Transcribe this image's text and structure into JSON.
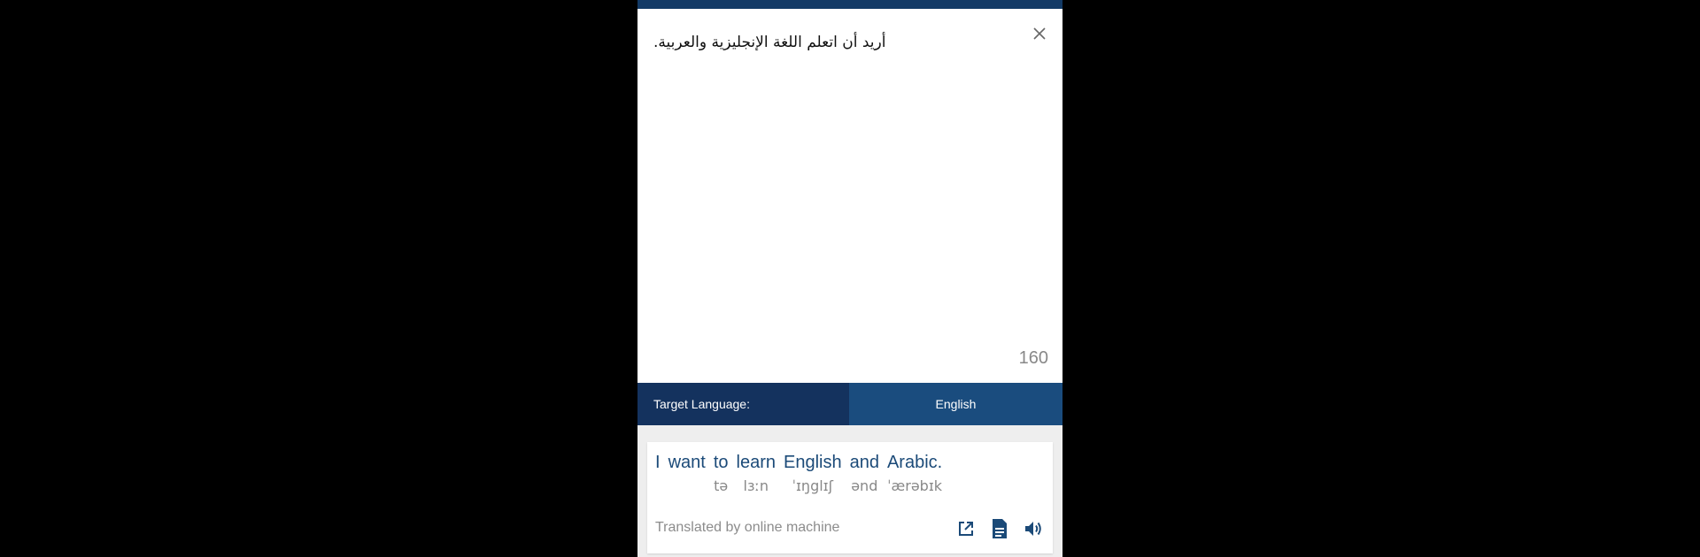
{
  "input": {
    "text": "أريد أن اتعلم اللغة الإنجليزية والعربية.",
    "char_count": "160",
    "close_icon": "close-icon"
  },
  "language_bar": {
    "label": "Target Language:",
    "selected": "English"
  },
  "result": {
    "words": [
      {
        "text": "I",
        "ipa": ""
      },
      {
        "text": "want",
        "ipa": ""
      },
      {
        "text": "to",
        "ipa": "tə"
      },
      {
        "text": "learn",
        "ipa": "lɜːn"
      },
      {
        "text": "English",
        "ipa": "ˈɪŋglɪʃ"
      },
      {
        "text": "and",
        "ipa": "ənd"
      },
      {
        "text": "Arabic.",
        "ipa": "ˈærəbɪk"
      }
    ],
    "credit": "Translated by online machine",
    "icons": [
      "open-external-icon",
      "document-icon",
      "speaker-icon"
    ]
  },
  "colors": {
    "header": "#133a66",
    "lang_label_bg": "#14325e",
    "lang_select_bg": "#1a4c7e",
    "word_color": "#1b4a78"
  }
}
